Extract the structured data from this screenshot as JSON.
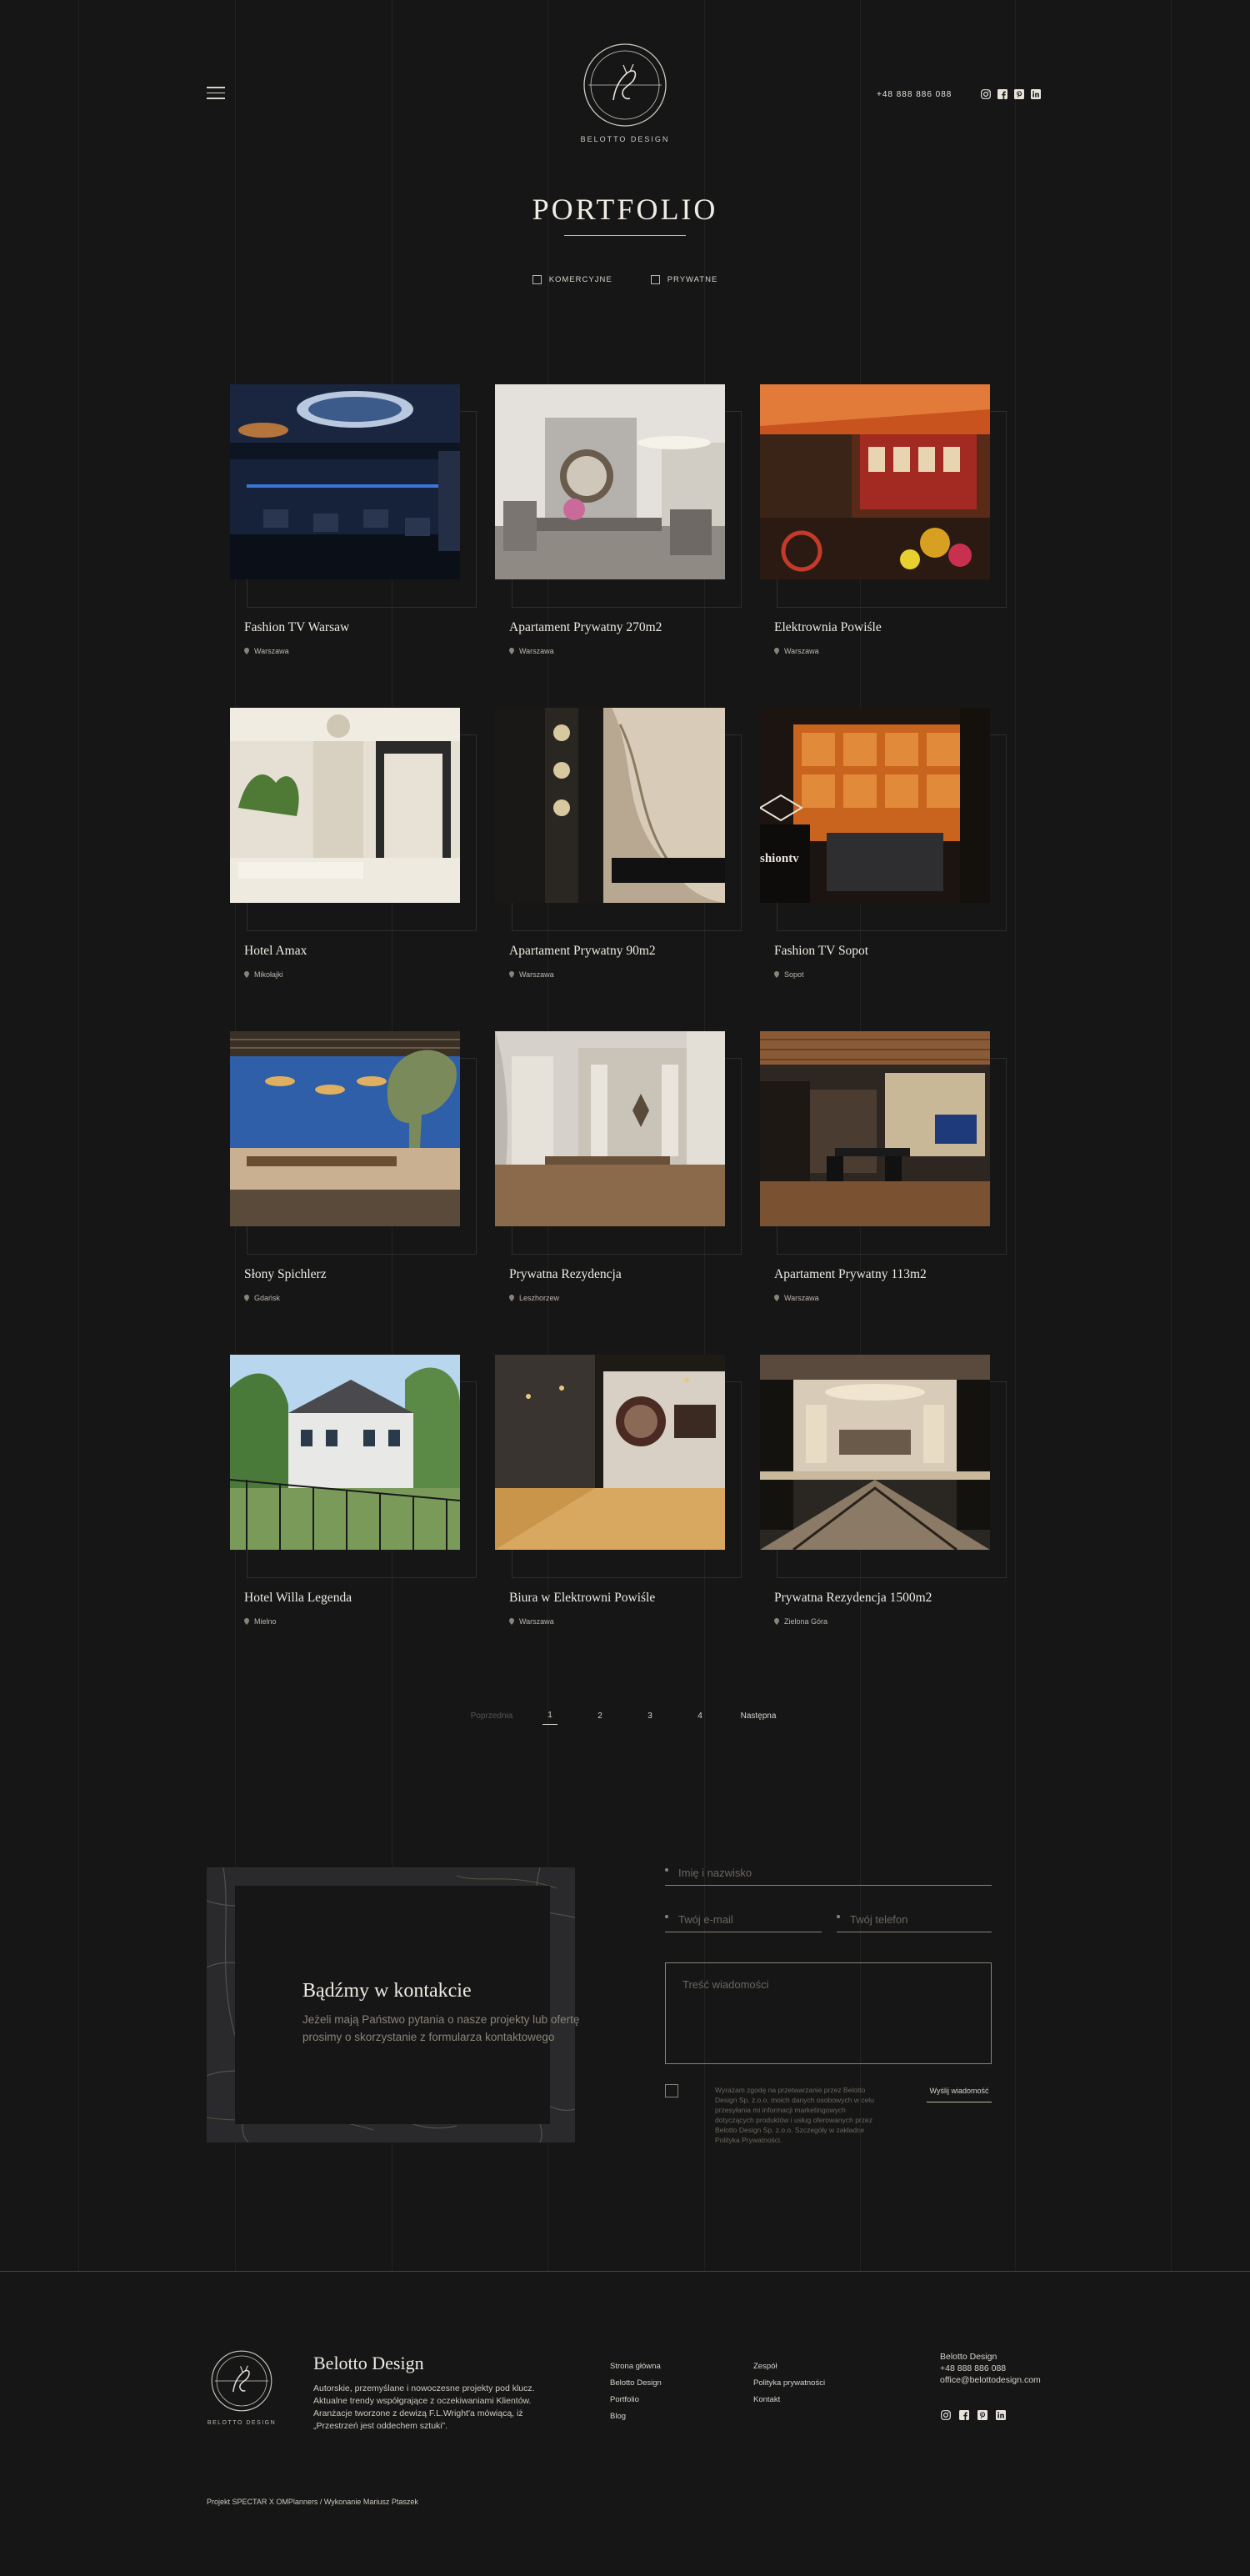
{
  "header": {
    "logo_text": "Belotto Design",
    "phone": "+48 888 886 088",
    "socials": [
      "instagram-icon",
      "facebook-icon",
      "pinterest-icon",
      "linkedin-icon"
    ]
  },
  "page": {
    "title": "PORTFOLIO"
  },
  "filters": [
    {
      "label": "KOMERCYJNE"
    },
    {
      "label": "PRYWATNE"
    }
  ],
  "projects": [
    {
      "name": "Fashion TV Warsaw",
      "location": "Warszawa"
    },
    {
      "name": "Apartament Prywatny 270m2",
      "location": "Warszawa"
    },
    {
      "name": "Elektrownia Powiśle",
      "location": "Warszawa"
    },
    {
      "name": "Hotel Amax",
      "location": "Mikołajki"
    },
    {
      "name": "Apartament Prywatny 90m2",
      "location": "Warszawa"
    },
    {
      "name": "Fashion TV Sopot",
      "location": "Sopot"
    },
    {
      "name": "Słony Spichlerz",
      "location": "Gdańsk"
    },
    {
      "name": "Prywatna Rezydencja",
      "location": "Leszhorzew"
    },
    {
      "name": "Apartament Prywatny 113m2",
      "location": "Warszawa"
    },
    {
      "name": "Hotel Willa Legenda",
      "location": "Mielno"
    },
    {
      "name": "Biura w Elektrowni Powiśle",
      "location": "Warszawa"
    },
    {
      "name": "Prywatna Rezydencja 1500m2",
      "location": "Zielona Góra"
    }
  ],
  "image_texts": {
    "fashiontv_sopot": "shiontv"
  },
  "pagination": {
    "prev": "Poprzednia",
    "pages": [
      "1",
      "2",
      "3",
      "4"
    ],
    "active": "1",
    "next": "Następna"
  },
  "contact": {
    "title": "Bądźmy w kontakcie",
    "description": "Jeżeli mają Państwo pytania o nasze projekty lub ofertę prosimy o skorzystanie z formularza kontaktowego",
    "name_placeholder": "Imię i nazwisko",
    "email_placeholder": "Twój e-mail",
    "phone_placeholder": "Twój telefon",
    "message_placeholder": "Treść wiadomości",
    "consent": "Wyrażam zgodę na przetwarzanie przez Belotto Design Sp. z.o.o. moich danych osobowych w celu przesyłania mi informacji marketingowych dotyczących produktów i usług oferowanych przez Belotto Design Sp. z.o.o. Szczegóły w zakładce Polityka Prywatności.",
    "submit": "Wyślij wiadomość"
  },
  "footer": {
    "logo_text": "Belotto Design",
    "brand": "Belotto Design",
    "description": "Autorskie, przemyślane i nowoczesne projekty pod klucz. Aktualne trendy współgrające z oczekiwaniami Klientów. Aranżacje tworzone z dewizą F.L.Wright'a mówiącą, iż „Przestrzeń jest oddechem sztuki”.",
    "nav_col1": [
      "Strona główna",
      "Belotto Design",
      "Portfolio",
      "Blog"
    ],
    "nav_col2": [
      "Zespół",
      "Polityka prywatności",
      "Kontakt"
    ],
    "company": "Belotto Design",
    "phone": "+48 888 886 088",
    "email": "office@belottodesign.com",
    "credits": "Projekt SPECTAR X OMPlanners / Wykonanie Mariusz Ptaszek"
  },
  "colors": {
    "background": "#161616",
    "text": "#e8e4dc",
    "muted": "#8a8478"
  }
}
